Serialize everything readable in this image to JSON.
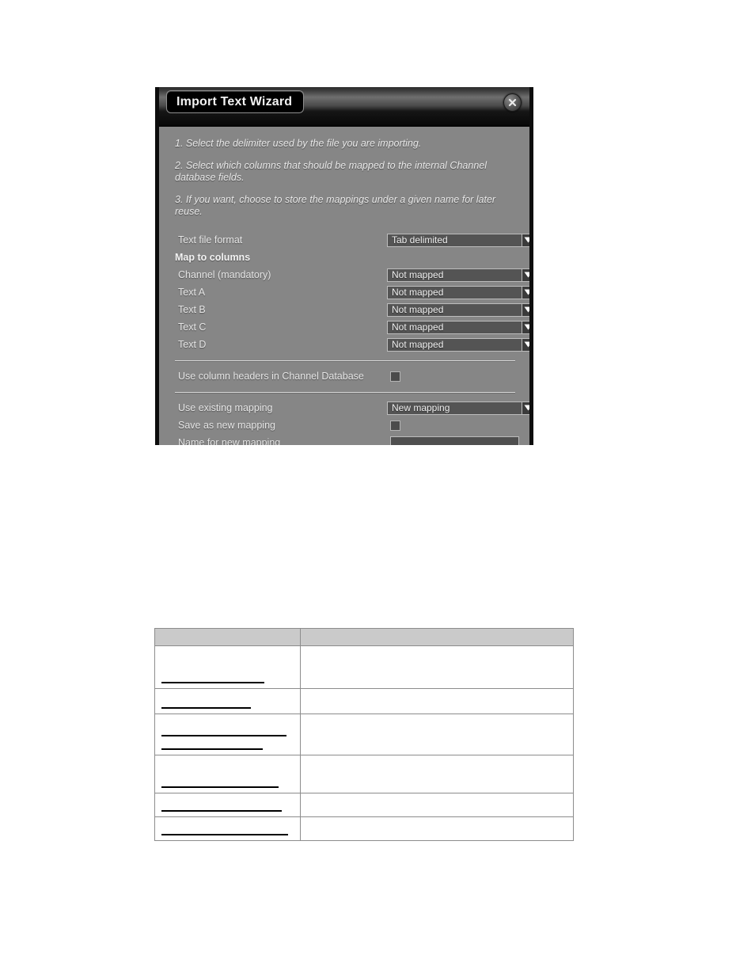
{
  "dialog": {
    "title": "Import Text Wizard",
    "close_icon": "close-circle-icon",
    "instructions": [
      "1. Select the delimiter used by the file you are importing.",
      "2. Select which columns that should be mapped to the internal Channel database fields.",
      "3. If you want, choose to store the mappings under a given name for later reuse."
    ],
    "fields": {
      "text_file_format": {
        "label": "Text file format",
        "value": "Tab delimited"
      },
      "section_map": {
        "label": "Map to columns"
      },
      "channel": {
        "label": "Channel (mandatory)",
        "value": "Not mapped"
      },
      "text_a": {
        "label": "Text A",
        "value": "Not mapped"
      },
      "text_b": {
        "label": "Text B",
        "value": "Not mapped"
      },
      "text_c": {
        "label": "Text C",
        "value": "Not mapped"
      },
      "text_d": {
        "label": "Text D",
        "value": "Not mapped"
      },
      "use_column_headers": {
        "label": "Use column headers in Channel Database",
        "checked": false
      },
      "use_existing_mapping": {
        "label": "Use existing mapping",
        "value": "New mapping"
      },
      "save_as_new_mapping": {
        "label": "Save as new mapping",
        "checked": false
      },
      "name_for_new_mapping": {
        "label": "Name for new mapping",
        "value": ""
      }
    },
    "dropdown_arrow_icon": "chevron-down-icon"
  },
  "table": {
    "header": {
      "col1": "",
      "col2": ""
    },
    "rows": [
      {
        "rules": [
          130
        ],
        "col2": ""
      },
      {
        "rules": [
          113
        ],
        "col2": ""
      },
      {
        "rules": [
          158,
          128
        ],
        "col2": ""
      },
      {
        "rules": [
          148
        ],
        "col2": ""
      },
      {
        "rules": [
          152
        ],
        "col2": ""
      },
      {
        "rules": [
          160
        ],
        "col2": ""
      }
    ]
  }
}
